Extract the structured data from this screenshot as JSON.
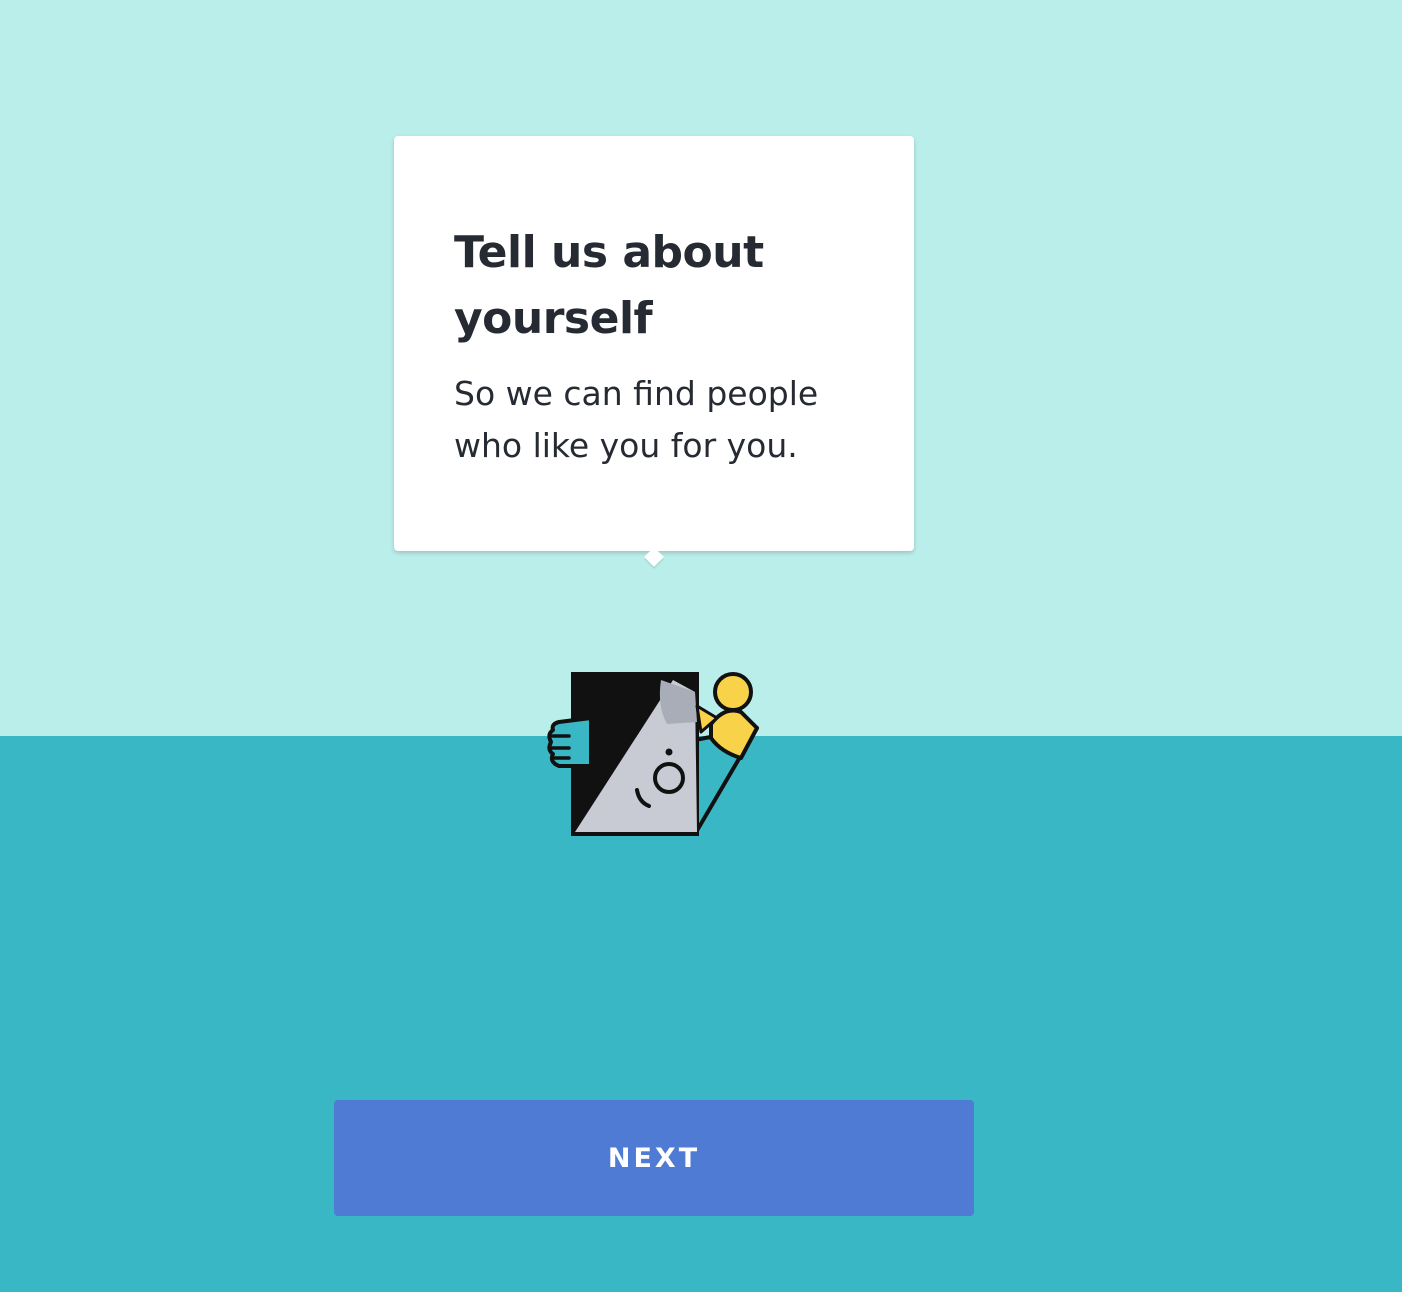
{
  "colors": {
    "background_top": "#baeeea",
    "background_bottom": "#3ab7c4",
    "button": "#4f7bd4",
    "text_dark": "#262b33"
  },
  "tooltip": {
    "title": "Tell us about yourself",
    "subtitle": "So we can find people who like you for you."
  },
  "illustration": {
    "icon": "character-holding-profile-card-icon"
  },
  "actions": {
    "next_label": "NEXT"
  }
}
